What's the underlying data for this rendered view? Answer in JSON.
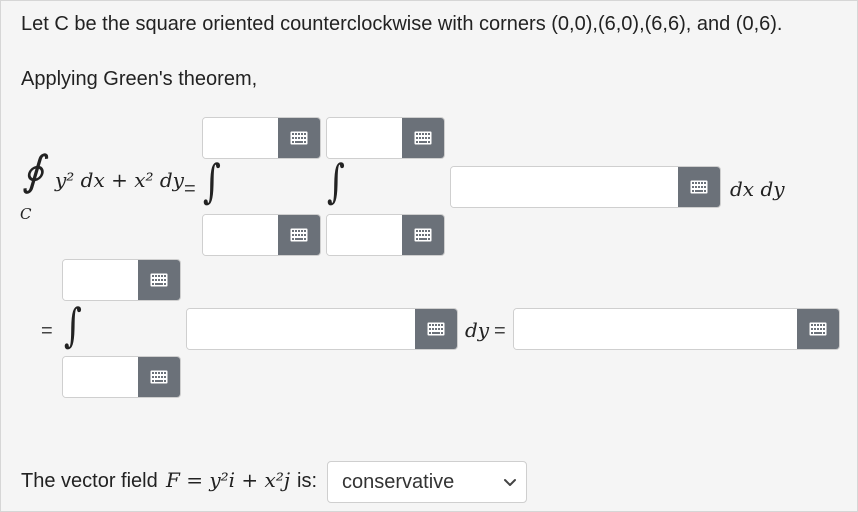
{
  "problem": {
    "statement": "Let C be the square oriented counterclockwise with corners (0,0),(6,0),(6,6), and (0,6).",
    "applying": "Applying Green's theorem,"
  },
  "math": {
    "contour_integral": "∮",
    "contour_sub": "C",
    "integrand_lhs": "y² dx + x² dy",
    "integral_sign": "∫",
    "equals": "=",
    "dxdy": "dx dy",
    "dy": "dy",
    "vector_field_prefix": "The vector field ",
    "vector_field_expr": "F = y²i + x²j",
    "vector_field_suffix": " is:"
  },
  "inputs": {
    "outer_upper_limit": "",
    "outer_lower_limit": "",
    "inner_upper_limit": "",
    "inner_lower_limit": "",
    "double_integrand": "",
    "single_upper_limit": "",
    "single_lower_limit": "",
    "single_integrand": "",
    "final_answer": ""
  },
  "select": {
    "selected": "conservative"
  },
  "icons": {
    "keyboard": "keyboard-icon",
    "chevron": "chevron-down-icon"
  },
  "colors": {
    "keyboard_button": "#6b7179",
    "background": "#f5f5f5"
  }
}
